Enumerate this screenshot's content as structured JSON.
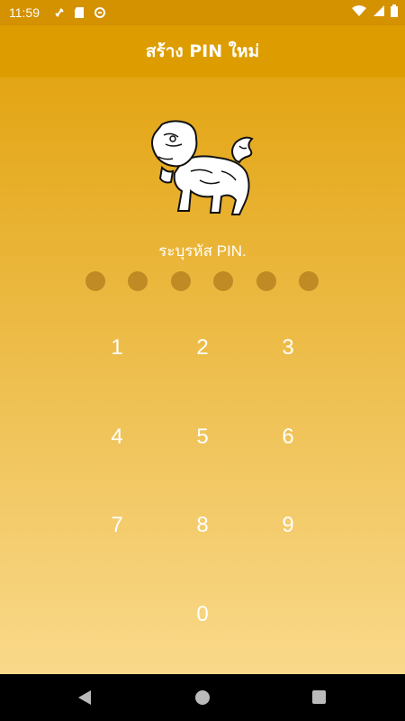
{
  "status_bar": {
    "time": "11:59",
    "left_icons": [
      "link-icon",
      "sd-card-icon",
      "sync-icon"
    ],
    "right_icons": [
      "wifi-icon",
      "signal-icon",
      "battery-icon"
    ]
  },
  "app_bar": {
    "title": "สร้าง PIN ใหม่"
  },
  "prompt": "ระบุรหัส PIN.",
  "pin": {
    "length": 6,
    "entered": 0
  },
  "keypad": {
    "keys": [
      "1",
      "2",
      "3",
      "4",
      "5",
      "6",
      "7",
      "8",
      "9",
      "0"
    ]
  },
  "nav": {
    "buttons": [
      "back-icon",
      "home-icon",
      "recents-icon"
    ]
  },
  "colors": {
    "status_bar": "#d49100",
    "app_bar": "#dd9d00",
    "gradient_top": "#e3a514",
    "gradient_bottom": "#f9d98a",
    "dot": "#b88320"
  }
}
